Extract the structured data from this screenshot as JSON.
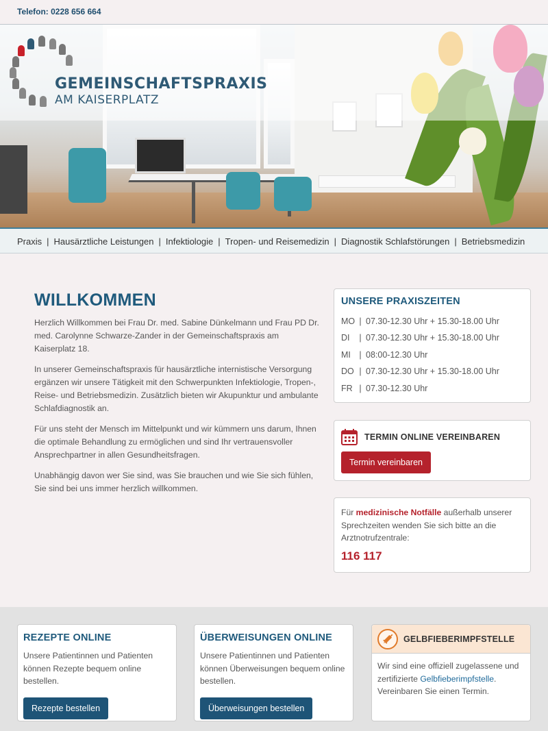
{
  "header": {
    "phone": "Telefon: 0228 656 664"
  },
  "logo": {
    "line1": "GEMEINSCHAFTSPRAXIS",
    "line2": "AM KAISERPLATZ"
  },
  "nav": {
    "items": [
      "Praxis",
      "Hausärztliche Leistungen",
      "Infektiologie",
      "Tropen- und Reisemedizin",
      "Diagnostik Schlafstörungen",
      "Betriebsmedizin"
    ],
    "separator": "|"
  },
  "main": {
    "title": "WILLKOMMEN",
    "paragraphs": [
      "Herzlich Willkommen bei Frau Dr. med. Sabine Dünkelmann und Frau PD Dr. med. Carolynne Schwarze-Zander in der Gemeinschaftspraxis am Kaiserplatz 18.",
      "In unserer Gemeinschaftspraxis für hausärztliche internistische Versorgung ergänzen wir unsere Tätigkeit mit den Schwerpunkten Infektiologie, Tropen-, Reise- und Betriebsmedizin. Zusätzlich bieten wir Akupunktur und ambulante Schlafdiagnostik an.",
      "Für uns steht der Mensch im Mittelpunkt und wir kümmern uns darum, Ihnen die optimale Behandlung zu ermöglichen und sind Ihr vertrauensvoller Ansprechpartner in allen Gesundheitsfragen.",
      "Unabhängig davon wer Sie sind, was Sie brauchen und wie Sie sich fühlen, Sie sind bei uns immer herzlich willkommen."
    ]
  },
  "hours": {
    "title": "UNSERE PRAXISZEITEN",
    "separator": "|",
    "rows": [
      {
        "day": "MO",
        "time": "07.30-12.30 Uhr + 15.30-18.00 Uhr"
      },
      {
        "day": "DI",
        "time": "07.30-12.30 Uhr + 15.30-18.00 Uhr"
      },
      {
        "day": "MI",
        "time": "08:00-12.30 Uhr"
      },
      {
        "day": "DO",
        "time": "07.30-12.30 Uhr + 15.30-18.00 Uhr"
      },
      {
        "day": "FR",
        "time": "07.30-12.30 Uhr"
      }
    ]
  },
  "termin": {
    "title": "TERMIN ONLINE VEREINBAREN",
    "button": "Termin vereinbaren",
    "icon": "calendar-icon"
  },
  "emergency": {
    "text_before": "Für ",
    "highlight": "medizinische Notfälle",
    "text_after": " außerhalb unserer Sprechzeiten wenden Sie sich bitte an die Arztnotrufzentrale:",
    "phone": "116 117"
  },
  "cards": {
    "rezepte": {
      "title": "REZEPTE ONLINE",
      "text": "Unsere Patientinnen und Patienten können Rezepte bequem online bestellen.",
      "button": "Rezepte bestellen"
    },
    "ueberweisungen": {
      "title": "ÜBERWEISUNGEN ONLINE",
      "text": "Unsere Patientinnen und Patienten können Überweisungen bequem online bestellen.",
      "button": "Überweisungen bestellen"
    },
    "gelbfieber": {
      "title": "GELBFIEBERIMPFSTELLE",
      "text_before": "Wir sind eine offiziell zugelassene und zertifizierte ",
      "link": "Gelbfieberimpfstelle",
      "text_after": ". Vereinbaren Sie einen Termin.",
      "icon": "syringe-icon"
    }
  },
  "colors": {
    "primary": "#1f5a7c",
    "accent_red": "#b5222c",
    "button_blue": "#1e5477",
    "orange": "#e07a2a"
  }
}
